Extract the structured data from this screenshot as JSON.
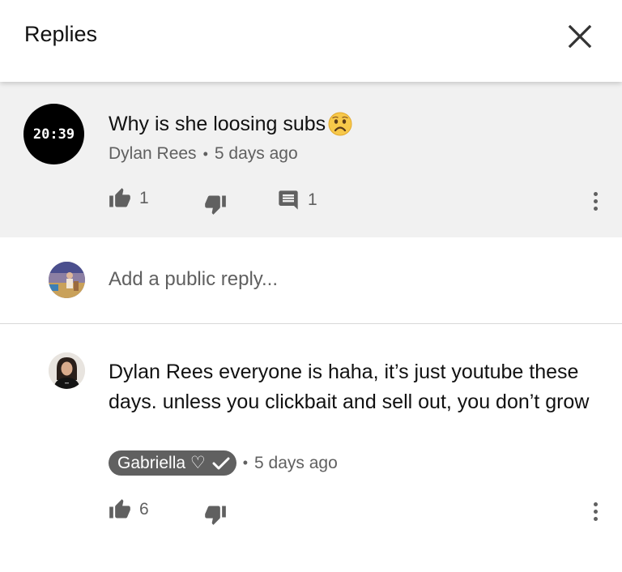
{
  "header": {
    "title": "Replies",
    "close_icon": "close-icon"
  },
  "parent_comment": {
    "avatar_text": "20:39",
    "text": "Why is she loosing subs",
    "emoji": "frowning-face-emoji",
    "author": "Dylan Rees",
    "separator": "•",
    "time": "5 days ago",
    "likes": "1",
    "replies": "1"
  },
  "reply_box": {
    "placeholder": "Add a public reply..."
  },
  "reply": {
    "text": "Dylan Rees everyone is haha, it’s just youtube these days. unless you clickbait and sell out, you don’t grow",
    "author": "Gabriella ♡",
    "separator": "•",
    "time": "5 days ago",
    "likes": "6"
  },
  "colors": {
    "header_bg": "#ffffff",
    "parent_bg": "#f1f1f1",
    "meta_text": "#606060",
    "badge_bg": "#606060"
  }
}
